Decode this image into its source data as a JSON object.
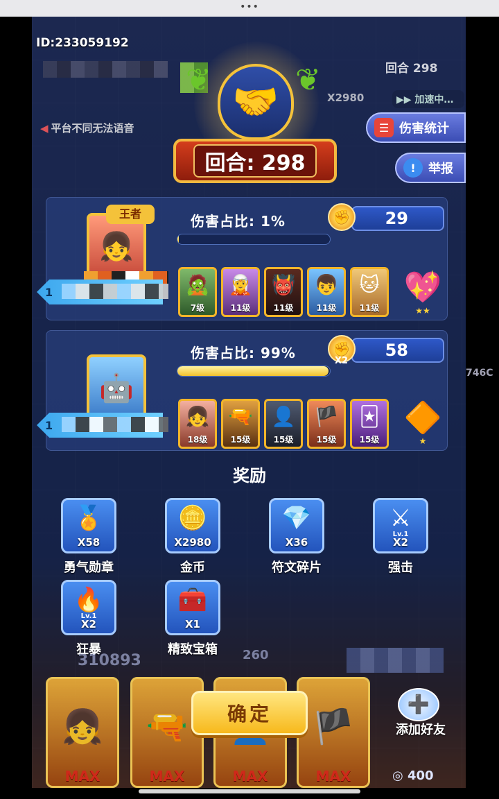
{
  "window": {
    "menu_dots": "•••"
  },
  "header": {
    "player_id": "ID:233059192"
  },
  "background": {
    "mute_note": "平台不同无法语音",
    "round_text": "回合 298",
    "coins_text": "X2980",
    "speed_text": "加速中…",
    "bottom_left_score": "310893",
    "bottom_mid_score": "260",
    "right_fragment": "746C"
  },
  "side_buttons": {
    "damage_stats": "伤害统计",
    "report": "举报"
  },
  "emblem": {
    "round_label": "回合: 298"
  },
  "players": [
    {
      "avatar_badge": "王者",
      "level_tag": "1",
      "damage_label": "伤害占比: 1%",
      "damage_percent": 1,
      "score": "29",
      "multiplier": "",
      "heroes": [
        {
          "level": "7级",
          "icon": "zombie-hero-icon"
        },
        {
          "level": "11级",
          "icon": "purple-hair-hero-icon"
        },
        {
          "level": "11级",
          "icon": "hooded-mage-hero-icon"
        },
        {
          "level": "11级",
          "icon": "blue-hair-hero-icon"
        },
        {
          "level": "11级",
          "icon": "cat-hero-icon"
        }
      ],
      "trophy_icon": "heart-trophy-icon",
      "trophy_stars": "★★"
    },
    {
      "avatar_badge": "",
      "level_tag": "1",
      "damage_label": "伤害占比: 99%",
      "damage_percent": 99,
      "score": "58",
      "multiplier": "X2",
      "heroes": [
        {
          "level": "18级",
          "icon": "girl-hero-icon"
        },
        {
          "level": "15级",
          "icon": "gunner-hero-icon"
        },
        {
          "level": "15级",
          "icon": "shadow-hero-icon"
        },
        {
          "level": "15级",
          "icon": "pirate-hero-icon"
        },
        {
          "level": "15级",
          "icon": "jester-hero-icon"
        }
      ],
      "trophy_icon": "amber-crystal-trophy-icon",
      "trophy_stars": "★"
    }
  ],
  "rewards": {
    "title": "奖励",
    "items": [
      {
        "name": "勇气勋章",
        "qty": "X58",
        "icon": "courage-medal-icon"
      },
      {
        "name": "金币",
        "qty": "X2980",
        "icon": "gold-coin-icon"
      },
      {
        "name": "符文碎片",
        "qty": "X36",
        "icon": "rune-shard-icon"
      },
      {
        "name": "强击",
        "qty": "X2",
        "icon": "power-strike-icon",
        "badge": "Lv.1"
      },
      {
        "name": "狂暴",
        "qty": "X2",
        "icon": "berserk-icon",
        "badge": "Lv.1"
      },
      {
        "name": "精致宝箱",
        "qty": "X1",
        "icon": "treasure-chest-icon"
      }
    ]
  },
  "bottom": {
    "confirm_label": "确定",
    "add_friend_label": "添加好友",
    "cost": "400",
    "max_label": "MAX"
  },
  "colors": {
    "accent_gold": "#f4c23a",
    "panel_blue": "#263c78",
    "score_blue": "#2e58c8",
    "confirm_yellow": "#f7b91c"
  }
}
